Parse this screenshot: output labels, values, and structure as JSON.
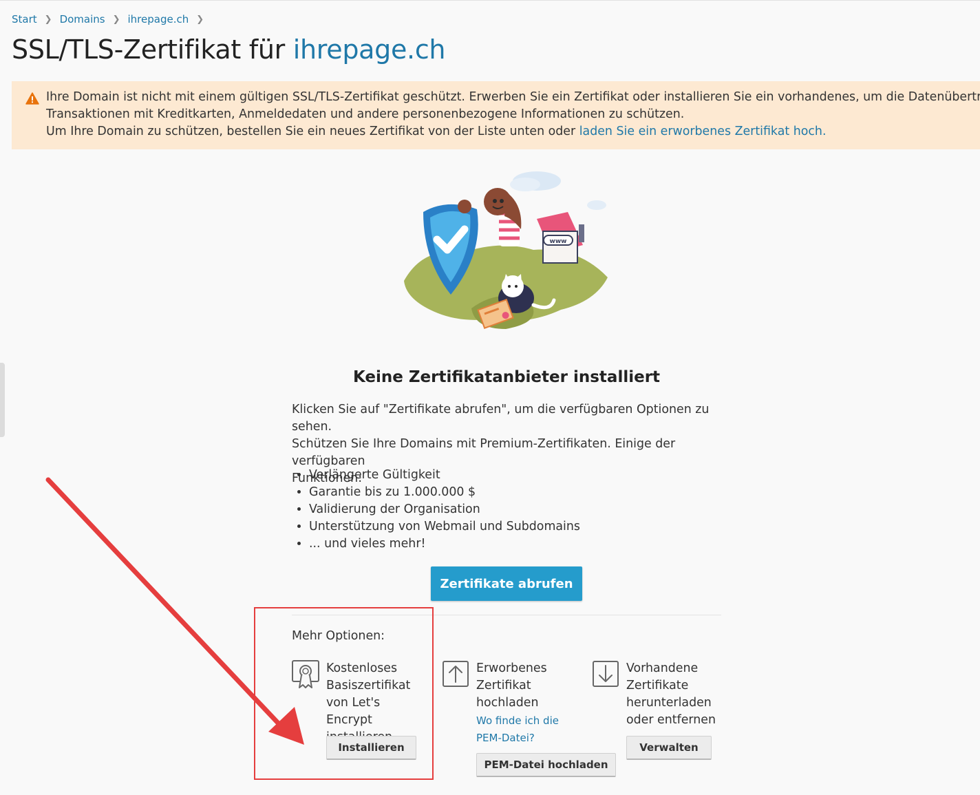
{
  "breadcrumb": {
    "items": [
      "Start",
      "Domains",
      "ihrepage.ch"
    ]
  },
  "title": {
    "prefix": "SSL/TLS-Zertifikat für",
    "domain": "ihrepage.ch"
  },
  "warning": {
    "line1": "Ihre Domain ist nicht mit einem gültigen SSL/TLS-Zertifikat geschützt. Erwerben Sie ein Zertifikat oder installieren Sie ein vorhandenes, um die Datenübertragung,",
    "line2": "Transaktionen mit Kreditkarten, Anmeldedaten und andere personenbezogene Informationen zu schützen.",
    "line3": "Um Ihre Domain zu schützen, bestellen Sie ein neues Zertifikat von der Liste unten oder",
    "link": "laden Sie ein erworbenes Zertifikat hoch."
  },
  "illustration": {
    "www_label": "www"
  },
  "main": {
    "heading": "Keine Zertifikatanbieter installiert",
    "intro_line1": "Klicken Sie auf \"Zertifikate abrufen\", um die verfügbaren Optionen zu sehen.",
    "intro_line2": "Schützen Sie Ihre Domains mit Premium-Zertifikaten. Einige der verfügbaren",
    "intro_line3": "Funktionen:",
    "features": [
      "Verlängerte Gültigkeit",
      "Garantie bis zu 1.000.000 $",
      "Validierung der Organisation",
      "Unterstützung von Webmail und Subdomains",
      "... und vieles mehr!"
    ],
    "primary_button": "Zertifikate abrufen"
  },
  "more_options": {
    "title": "Mehr Optionen:",
    "letsencrypt": {
      "lines": [
        "Kostenloses",
        "Basiszertifikat",
        "von Let's Encrypt",
        "installieren"
      ],
      "button": "Installieren",
      "icon": "certificate-icon"
    },
    "upload": {
      "lines": [
        "Erworbenes",
        "Zertifikat",
        "hochladen"
      ],
      "help_lines": [
        "Wo finde ich die",
        "PEM-Datei?"
      ],
      "button": "PEM-Datei hochladen",
      "icon": "upload-icon"
    },
    "manage": {
      "lines": [
        "Vorhandene",
        "Zertifikate",
        "herunterladen",
        "oder entfernen"
      ],
      "button": "Verwalten",
      "icon": "download-icon"
    }
  },
  "colors": {
    "accent": "#259ccc",
    "link": "#1f78a8",
    "warning_bg": "#fde9d2",
    "annotation": "#e53e3e"
  }
}
